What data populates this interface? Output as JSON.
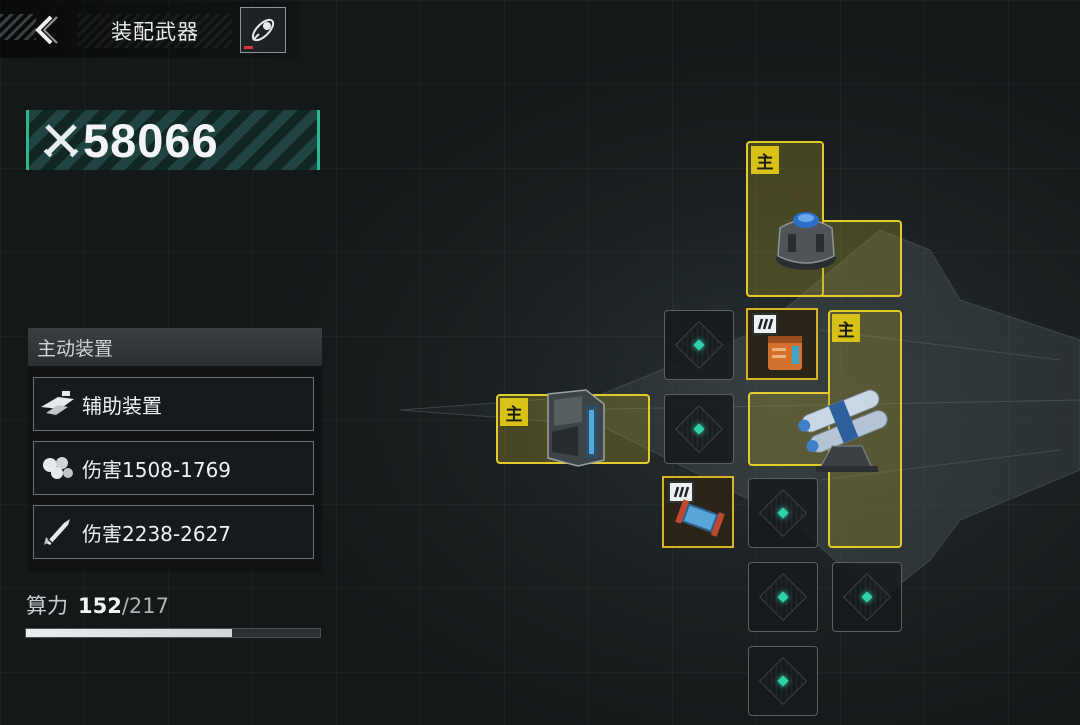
{
  "header": {
    "title": "装配武器"
  },
  "combat_power": "58066",
  "active_devices": {
    "heading": "主动装置",
    "items": [
      {
        "label": "辅助装置",
        "icon": "drone-swarm-icon"
      },
      {
        "label": "伤害1508-1769",
        "icon": "cluster-bomb-icon"
      },
      {
        "label": "伤害2238-2627",
        "icon": "missile-icon"
      }
    ]
  },
  "capacity": {
    "label": "算力",
    "used": "152",
    "separator": "/",
    "max": "217",
    "fraction": 0.7
  },
  "slots": {
    "main_badge": "主",
    "empty_count": 6
  },
  "colors": {
    "accent_green": "#2db894",
    "slot_gold": "#e2cc2a",
    "slot_dot": "#2fd1a7"
  }
}
